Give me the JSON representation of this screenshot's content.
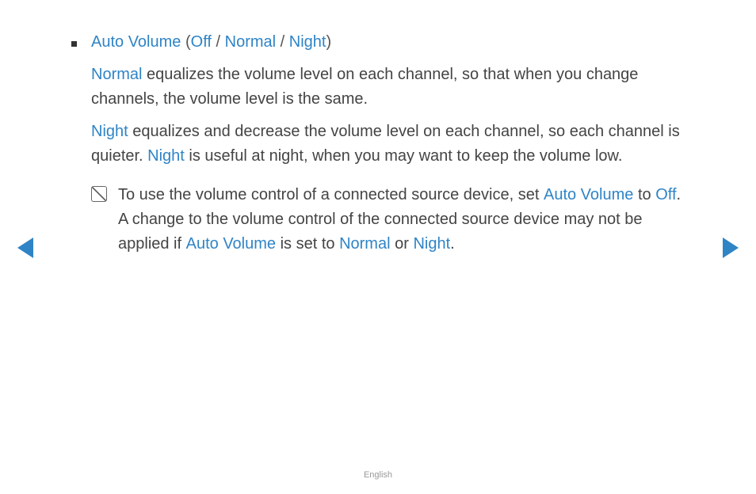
{
  "item": {
    "title": "Auto Volume",
    "options": {
      "off": "Off",
      "normal": "Normal",
      "night": "Night"
    },
    "para1": {
      "lead": "Normal",
      "rest": " equalizes the volume level on each channel, so that when you change channels, the volume level is the same."
    },
    "para2": {
      "lead": "Night",
      "mid1": " equalizes and decrease the volume level on each channel, so each channel is quieter. ",
      "lead2": "Night",
      "rest": " is useful at night, when you may want to keep the volume low."
    },
    "note": {
      "t1": "To use the volume control of a connected source device, set ",
      "k1": "Auto Volume",
      "t2": " to ",
      "k2": "Off",
      "t3": ". A change to the volume control of the connected source device may not be applied if ",
      "k3": "Auto Volume",
      "t4": " is set to ",
      "k4": "Normal",
      "t5": " or ",
      "k5": "Night",
      "t6": "."
    }
  },
  "footer": "English"
}
